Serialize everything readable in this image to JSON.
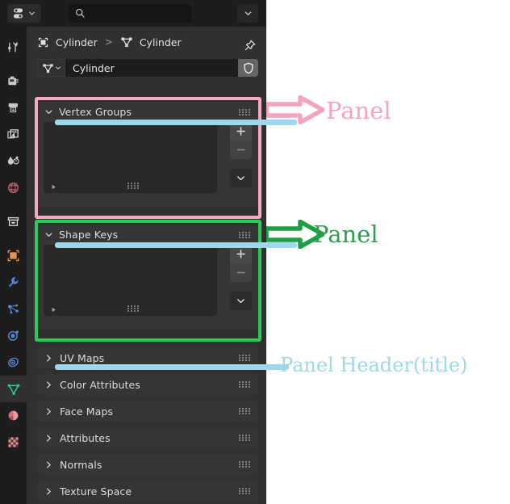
{
  "app": {
    "name": "Blender Properties Editor"
  },
  "header": {
    "editor_type_icon": "properties-editor-icon",
    "editor_type_chevron": "chevron-down-icon",
    "search": {
      "icon": "search-icon",
      "value": "",
      "placeholder": ""
    },
    "dropdown_icon": "chevron-down-icon"
  },
  "tabs": [
    {
      "name": "tool",
      "icon": "tool-icon",
      "active": false
    },
    {
      "name": "render",
      "icon": "render-camera-icon",
      "active": false
    },
    {
      "name": "output",
      "icon": "output-printer-icon",
      "active": false
    },
    {
      "name": "view-layer",
      "icon": "view-layer-images-icon",
      "active": false
    },
    {
      "name": "scene",
      "icon": "scene-cone-droplet-icon",
      "active": false
    },
    {
      "name": "world",
      "icon": "world-globe-icon",
      "active": false
    },
    {
      "name": "collection",
      "icon": "collection-box-icon",
      "active": false
    },
    {
      "name": "object",
      "icon": "object-square-icon",
      "active": false
    },
    {
      "name": "modifiers",
      "icon": "wrench-icon",
      "active": false
    },
    {
      "name": "particles",
      "icon": "particles-icon",
      "active": false
    },
    {
      "name": "physics",
      "icon": "physics-orbit-icon",
      "active": false
    },
    {
      "name": "object-constraints",
      "icon": "constraints-icon",
      "active": false
    },
    {
      "name": "object-data",
      "icon": "mesh-data-triangle-icon",
      "active": true
    },
    {
      "name": "material",
      "icon": "material-sphere-icon",
      "active": false
    },
    {
      "name": "texture",
      "icon": "texture-checker-icon",
      "active": false
    }
  ],
  "breadcrumb": {
    "object_icon": "object-square-icon",
    "object_name": "Cylinder",
    "separator": ">",
    "data_icon": "mesh-data-triangle-icon",
    "data_name": "Cylinder",
    "pin_icon": "pin-icon"
  },
  "name_row": {
    "id_icon": "mesh-data-triangle-icon",
    "id_chevron": "chevron-down-icon",
    "value": "Cylinder",
    "shield_icon": "shield-fake-user-icon"
  },
  "panels": [
    {
      "title": "Vertex Groups",
      "expanded": true,
      "disclosure_icon": "chevron-down-icon",
      "grip_icon": "drag-grip-icon",
      "list_expand_icon": "triangle-right-icon",
      "list_grip_icon": "drag-grip-icon",
      "buttons": [
        {
          "name": "add",
          "label": "+",
          "icon": "plus-icon"
        },
        {
          "name": "remove",
          "label": "−",
          "icon": "minus-icon"
        },
        {
          "name": "specials",
          "label": "",
          "icon": "chevron-down-icon"
        }
      ]
    },
    {
      "title": "Shape Keys",
      "expanded": true,
      "disclosure_icon": "chevron-down-icon",
      "grip_icon": "drag-grip-icon",
      "list_expand_icon": "triangle-right-icon",
      "list_grip_icon": "drag-grip-icon",
      "buttons": [
        {
          "name": "add",
          "label": "+",
          "icon": "plus-icon"
        },
        {
          "name": "remove",
          "label": "−",
          "icon": "minus-icon"
        },
        {
          "name": "specials",
          "label": "",
          "icon": "chevron-down-icon"
        }
      ]
    }
  ],
  "collapsed_panels": [
    {
      "title": "UV Maps",
      "disclosure_icon": "chevron-right-icon",
      "grip_icon": "drag-grip-icon"
    },
    {
      "title": "Color Attributes",
      "disclosure_icon": "chevron-right-icon",
      "grip_icon": "drag-grip-icon"
    },
    {
      "title": "Face Maps",
      "disclosure_icon": "chevron-right-icon",
      "grip_icon": "drag-grip-icon"
    },
    {
      "title": "Attributes",
      "disclosure_icon": "chevron-right-icon",
      "grip_icon": "drag-grip-icon"
    },
    {
      "title": "Normals",
      "disclosure_icon": "chevron-right-icon",
      "grip_icon": "drag-grip-icon"
    },
    {
      "title": "Texture Space",
      "disclosure_icon": "chevron-right-icon",
      "grip_icon": "drag-grip-icon"
    }
  ],
  "annotations": [
    {
      "name": "panel-pink",
      "text": "Panel",
      "color": "#f5a3c0"
    },
    {
      "name": "panel-green",
      "text": "Panel",
      "color": "#2e9e4f"
    },
    {
      "name": "panel-header",
      "text": "Panel Header(title)",
      "color": "#9ed7ec"
    }
  ],
  "colors": {
    "highlight_pink": "#f9a9c4",
    "highlight_green": "#2eca57",
    "highlight_blue": "#9ed7ec",
    "editor_bg": "#303030",
    "header_bg": "#1d1d1d",
    "panel_bg": "#353535",
    "field_bg": "#1d1d1d",
    "active_tab_mesh": "#2ecc8f"
  }
}
